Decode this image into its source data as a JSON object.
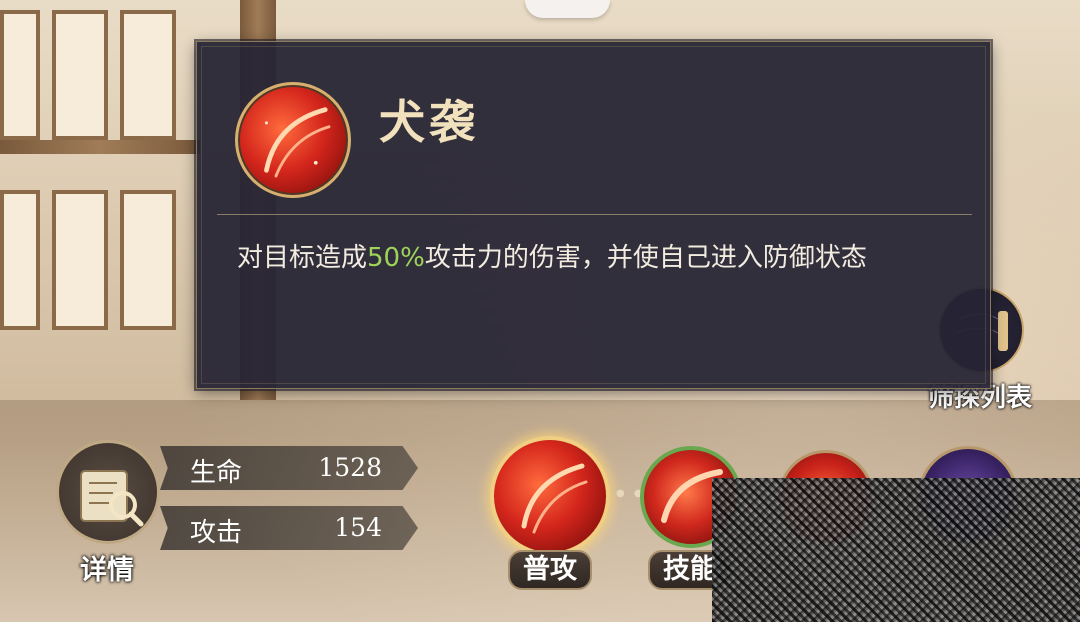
{
  "tooltip": {
    "title": "犬袭",
    "description_pre": "对目标造成",
    "description_highlight": "50%",
    "description_post": "攻击力的伤害，并使自己进入防御状态",
    "icon": "red-slash-skill-icon",
    "highlight_color": "#9ed35a"
  },
  "side_button": {
    "label": "筛探列表",
    "icon": "scroll-list-icon"
  },
  "stats": {
    "details_label": "详情",
    "details_icon": "map-magnifier-icon",
    "hp_label": "生命",
    "hp_value": "1528",
    "atk_label": "攻击",
    "atk_value": "154"
  },
  "skill_bar": {
    "normal_attack_label": "普攻",
    "skill_label": "技能"
  }
}
